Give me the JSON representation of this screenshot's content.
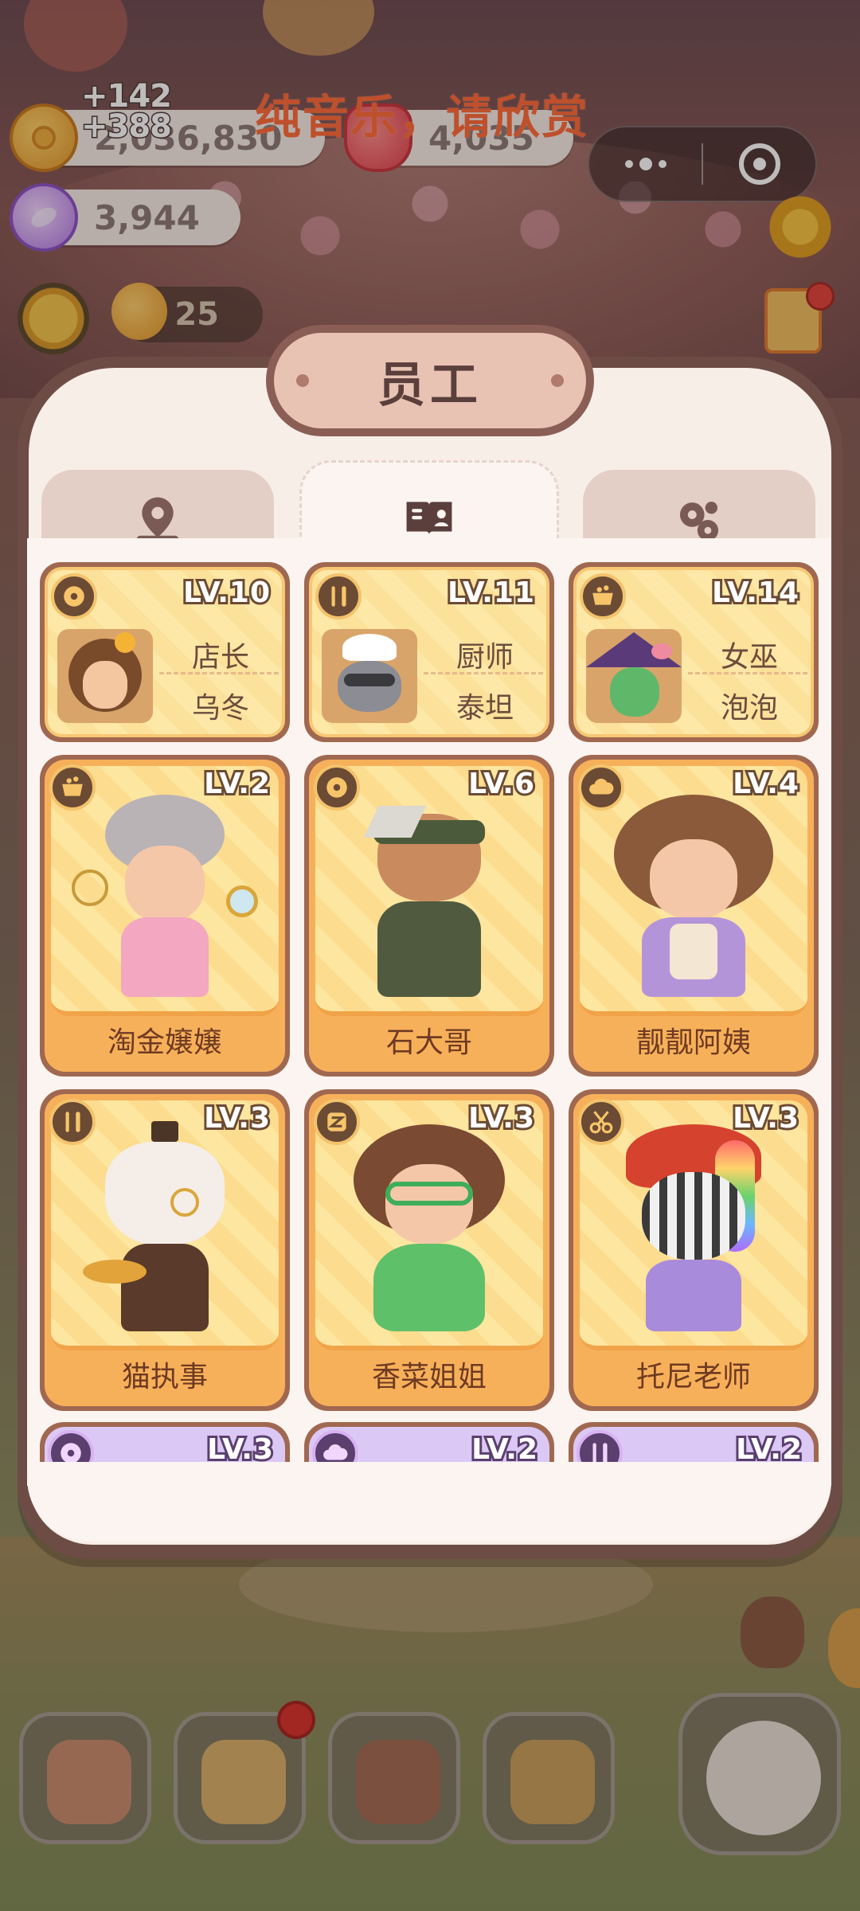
{
  "hud": {
    "coins": "2,036,830",
    "coin_gain_1": "+142",
    "coin_gain_2": "+388",
    "hearts": "4,035",
    "gems": "3,944",
    "level": "25",
    "caption": "纯音乐，请欣赏"
  },
  "panel": {
    "title": "员工",
    "tabs": [
      {
        "icon": "location-pin-icon",
        "active": false
      },
      {
        "icon": "open-book-icon",
        "active": true
      },
      {
        "icon": "gears-icon",
        "active": false
      }
    ]
  },
  "featured_staff": [
    {
      "lv": "LV.10",
      "role": "店长",
      "name": "乌冬",
      "skill_icon": "donut-icon"
    },
    {
      "lv": "LV.11",
      "role": "厨师",
      "name": "泰坦",
      "skill_icon": "fork-knife-icon"
    },
    {
      "lv": "LV.14",
      "role": "女巫",
      "name": "泡泡",
      "skill_icon": "cauldron-icon"
    }
  ],
  "staff": [
    {
      "lv": "LV.2",
      "name": "淘金嬢嬢",
      "skill_icon": "cauldron-icon"
    },
    {
      "lv": "LV.6",
      "name": "石大哥",
      "skill_icon": "donut-icon"
    },
    {
      "lv": "LV.4",
      "name": "靓靓阿姨",
      "skill_icon": "cloud-icon"
    },
    {
      "lv": "LV.3",
      "name": "猫执事",
      "skill_icon": "fork-knife-icon"
    },
    {
      "lv": "LV.3",
      "name": "香菜姐姐",
      "skill_icon": "z-badge-icon"
    },
    {
      "lv": "LV.3",
      "name": "托尼老师",
      "skill_icon": "scissors-icon"
    }
  ],
  "staff_partial": [
    {
      "lv": "LV.3",
      "skill_icon": "donut-icon"
    },
    {
      "lv": "LV.2",
      "skill_icon": "cloud-icon"
    },
    {
      "lv": "LV.2",
      "skill_icon": "fork-knife-icon"
    }
  ],
  "colors": {
    "caption": "#ff6b3a",
    "card_yellow": "#f7b05a",
    "card_purple": "#dcc8f5",
    "panel_frame": "#6d4c46",
    "badge_red": "#d8332d"
  }
}
